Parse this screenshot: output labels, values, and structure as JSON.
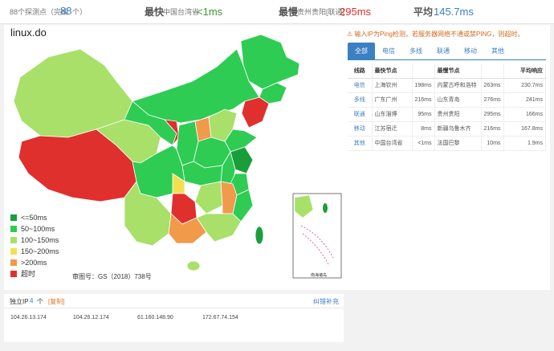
{
  "summary": {
    "probe_prefix": "88个探测点（完成",
    "done_count": "88",
    "probe_suffix": "个）",
    "fastest_label": "最快",
    "fastest_location": "中国台湾省",
    "fastest_value": "<1ms",
    "slowest_label": "最慢",
    "slowest_location": "贵州贵阳[联通]",
    "slowest_value": "295ms",
    "avg_label": "平均",
    "avg_value": "145.7ms"
  },
  "map": {
    "title": "linux.do",
    "approval": "审图号：GS（2018）738号",
    "inset_label": "南海诸岛",
    "legend": [
      {
        "label": "<=50ms",
        "color": "#1a9e3a"
      },
      {
        "label": "50~100ms",
        "color": "#2ecc53"
      },
      {
        "label": "100~150ms",
        "color": "#a8e06a"
      },
      {
        "label": "150~200ms",
        "color": "#f3e052"
      },
      {
        "label": ">200ms",
        "color": "#f09a4a"
      },
      {
        "label": "超时",
        "color": "#e0302e"
      }
    ]
  },
  "panel": {
    "notice": "输入IP为Ping检测，若服务器网络不通或禁PING，则超时。",
    "tabs": [
      "全部",
      "电信",
      "多线",
      "联通",
      "移动",
      "其他"
    ],
    "headers": [
      "线路",
      "最快节点",
      "",
      "最慢节点",
      "",
      "平均响应"
    ],
    "rows": [
      {
        "line": "电信",
        "fast": "上海钦州",
        "fast_ms": "198ms",
        "slow": "内蒙古呼和浩特",
        "slow_ms": "263ms",
        "avg": "230.7ms"
      },
      {
        "line": "多线",
        "fast": "广东广州",
        "fast_ms": "216ms",
        "slow": "山东青岛",
        "slow_ms": "276ms",
        "avg": "241ms"
      },
      {
        "line": "联通",
        "fast": "山东淄博",
        "fast_ms": "95ms",
        "slow": "贵州贵阳",
        "slow_ms": "295ms",
        "avg": "166ms"
      },
      {
        "line": "移动",
        "fast": "江苏宿迁",
        "fast_ms": "8ms",
        "slow": "新疆乌鲁木齐",
        "slow_ms": "216ms",
        "avg": "167.8ms"
      },
      {
        "line": "其他",
        "fast": "中国台湾省",
        "fast_ms": "<1ms",
        "slow": "法国巴黎",
        "slow_ms": "10ms",
        "avg": "1.9ms"
      }
    ]
  },
  "ips": {
    "label": "独立IP",
    "count": "4",
    "unit": "个",
    "copy_label": "[复制]",
    "report_label": "纠错补充",
    "list": [
      "104.26.13.174",
      "104.26.12.174",
      "61.160.148.90",
      "172.67.74.154"
    ]
  }
}
